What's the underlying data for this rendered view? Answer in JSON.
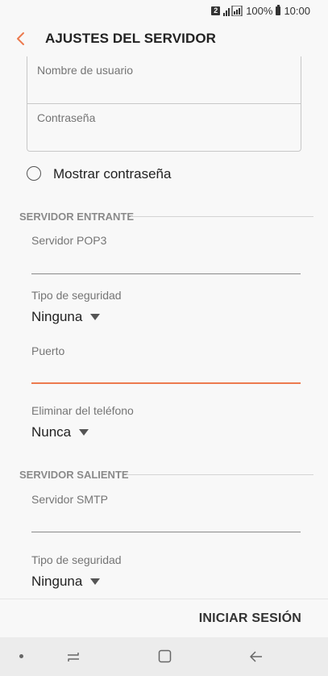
{
  "status_bar": {
    "sim_slot": "2",
    "battery": "100%",
    "time": "10:00"
  },
  "app_bar": {
    "title": "AJUSTES DEL SERVIDOR",
    "back_icon": "chevron-left-icon",
    "accent_color": "#ec7a4e"
  },
  "credentials": {
    "username_placeholder": "Nombre de usuario",
    "password_placeholder": "Contraseña"
  },
  "show_password": {
    "label": "Mostrar contraseña",
    "checked": false
  },
  "incoming": {
    "header": "SERVIDOR ENTRANTE",
    "server_label": "Servidor POP3",
    "server_value": "",
    "security_label": "Tipo de seguridad",
    "security_value": "Ninguna",
    "port_label": "Puerto",
    "port_value": "",
    "delete_label": "Eliminar del teléfono",
    "delete_value": "Nunca"
  },
  "outgoing": {
    "header": "SERVIDOR SALIENTE",
    "server_label": "Servidor SMTP",
    "server_value": "",
    "security_label": "Tipo de seguridad",
    "security_value": "Ninguna"
  },
  "footer": {
    "signin_label": "INICIAR SESIÓN"
  },
  "nav_bar": {
    "icons": [
      "dot-icon",
      "recent-apps-icon",
      "home-icon",
      "back-arrow-icon"
    ]
  }
}
